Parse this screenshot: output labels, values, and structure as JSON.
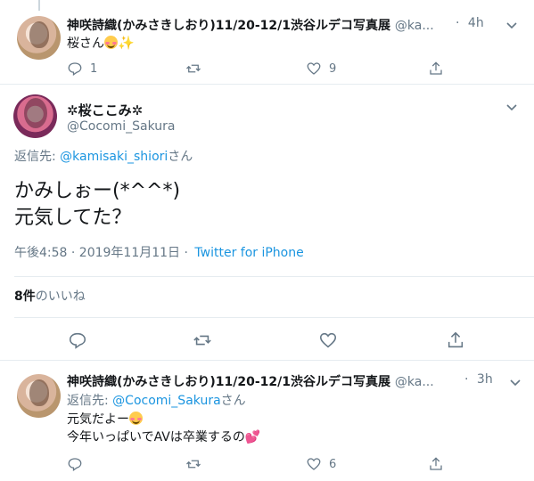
{
  "tweet1": {
    "name": "神咲詩織(かみさきしおり)11/20-12/1渋谷ルデコ写真展",
    "handle": "@ka...",
    "dot": "·",
    "time": "4h",
    "text": "桜さん",
    "replies": "1",
    "retweets": "",
    "likes": "9"
  },
  "main": {
    "name": "✲桜ここみ✲",
    "handle": "@Cocomi_Sakura",
    "reply_to_label": "返信先:",
    "reply_to_handle": "@kamisaki_shiori",
    "reply_to_suffix": "さん",
    "line1": "かみしぉー(*^^*)",
    "line2": "元気してた？",
    "timestamp": "午後4:58 · 2019年11月11日 ·",
    "source": "Twitter for iPhone",
    "likes_count": "8件",
    "likes_label": "のいいね"
  },
  "tweet2": {
    "name": "神咲詩織(かみさきしおり)11/20-12/1渋谷ルデコ写真展",
    "handle": "@ka...",
    "dot": "·",
    "time": "3h",
    "reply_to_label": "返信先:",
    "reply_to_handle": "@Cocomi_Sakura",
    "reply_to_suffix": "さん",
    "line1": "元気だよー",
    "line2": "今年いっぱいでAVは卒業するの",
    "replies": "",
    "retweets": "",
    "likes": "6"
  },
  "colors": {
    "link": "#1b95e0",
    "secondary": "#657786",
    "divider": "#e6ecf0"
  }
}
